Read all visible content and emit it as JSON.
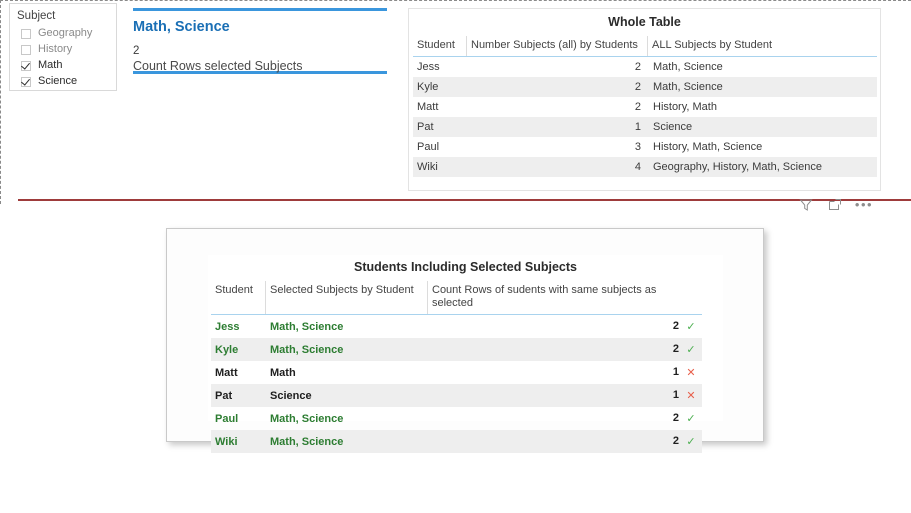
{
  "slicer": {
    "title": "Subject",
    "items": [
      {
        "label": "Geography",
        "checked": false
      },
      {
        "label": "History",
        "checked": false
      },
      {
        "label": "Math",
        "checked": true
      },
      {
        "label": "Science",
        "checked": true
      }
    ]
  },
  "card": {
    "title": "Math, Science",
    "value": "2",
    "caption": "Count Rows selected Subjects",
    "accent_color": "#3a96dd"
  },
  "whole_table": {
    "title": "Whole Table",
    "columns": [
      "Student",
      "Number Subjects (all) by Students",
      "ALL Subjects by Student"
    ],
    "rows": [
      {
        "student": "Jess",
        "count": "2",
        "subjects": "Math, Science"
      },
      {
        "student": "Kyle",
        "count": "2",
        "subjects": "Math, Science"
      },
      {
        "student": "Matt",
        "count": "2",
        "subjects": "History, Math"
      },
      {
        "student": "Pat",
        "count": "1",
        "subjects": "Science"
      },
      {
        "student": "Paul",
        "count": "3",
        "subjects": "History, Math, Science"
      },
      {
        "student": "Wiki",
        "count": "4",
        "subjects": "Geography, History, Math, Science"
      }
    ]
  },
  "visual_actions": {
    "filter_label": "Filters",
    "focus_label": "Focus mode",
    "more_label": "More options",
    "more_glyph": "•••"
  },
  "selected_table": {
    "title": "Students Including Selected Subjects",
    "columns": [
      "Student",
      "Selected Subjects by Student",
      "Count Rows of sudents with same subjects as selected"
    ],
    "rows": [
      {
        "student": "Jess",
        "subjects": "Math, Science",
        "count": "2",
        "mark": "check",
        "match": true
      },
      {
        "student": "Kyle",
        "subjects": "Math, Science",
        "count": "2",
        "mark": "check",
        "match": true
      },
      {
        "student": "Matt",
        "subjects": "Math",
        "count": "1",
        "mark": "cross",
        "match": false
      },
      {
        "student": "Pat",
        "subjects": "Science",
        "count": "1",
        "mark": "cross",
        "match": false
      },
      {
        "student": "Paul",
        "subjects": "Math, Science",
        "count": "2",
        "mark": "check",
        "match": true
      },
      {
        "student": "Wiki",
        "subjects": "Math, Science",
        "count": "2",
        "mark": "check",
        "match": true
      }
    ],
    "check_glyph": "✓",
    "cross_glyph": "✕",
    "check_color": "#4caf50",
    "cross_color": "#e8604c"
  },
  "divider": {
    "color": "#9e3b3b"
  }
}
